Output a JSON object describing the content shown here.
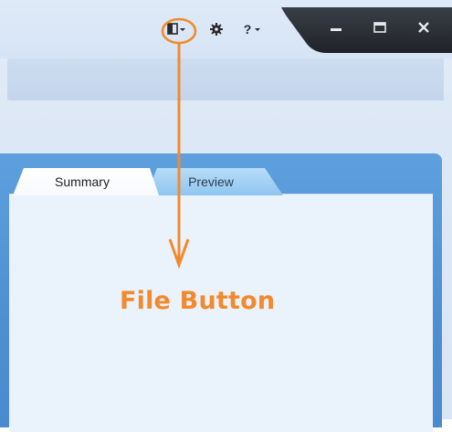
{
  "titlebar": {
    "icons": {
      "file": "file-button-icon",
      "settings": "gear-icon",
      "help": "help-icon",
      "minimize": "minimize-icon",
      "maximize": "maximize-icon",
      "close": "close-icon"
    },
    "help_label": "?"
  },
  "tabs": [
    {
      "label": "Summary",
      "selected": true
    },
    {
      "label": "Preview",
      "selected": false
    }
  ],
  "annotation": {
    "label": "File Button",
    "color": "#f28a2d"
  },
  "colors": {
    "panel_blue": "#4e8fd2",
    "titlebar_dark": "#2b2f36",
    "accent_orange": "#f28a2d"
  }
}
